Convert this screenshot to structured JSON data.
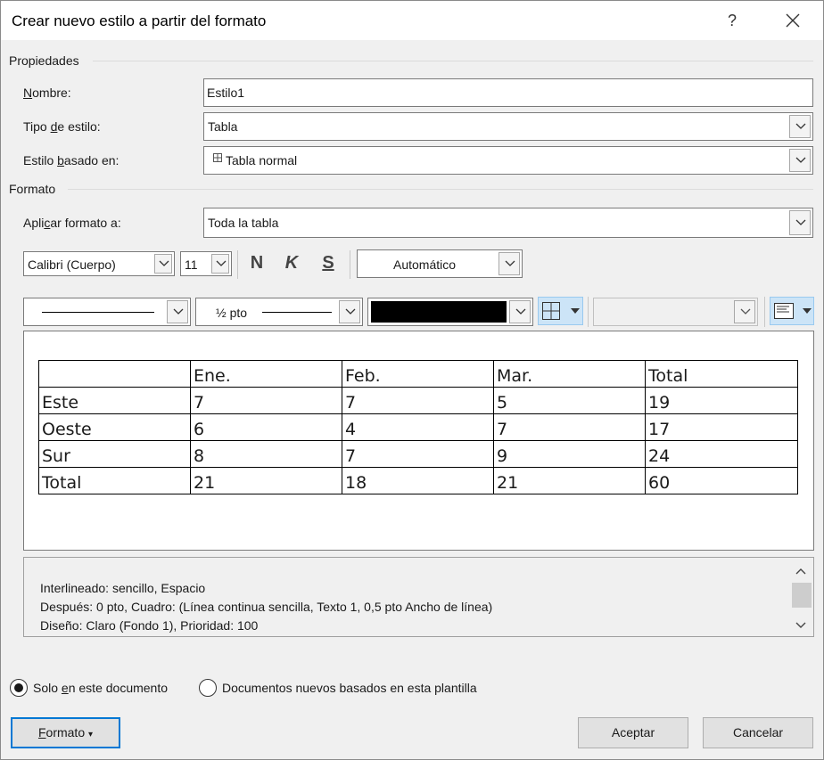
{
  "dialog": {
    "title": "Crear nuevo estilo a partir del formato",
    "help_label": "?"
  },
  "properties": {
    "section_label": "Propiedades",
    "name": {
      "label_prefix": "",
      "label_ul": "N",
      "label_rest": "ombre:",
      "value": "Estilo1"
    },
    "type": {
      "label_prefix": "Tipo ",
      "label_ul": "d",
      "label_rest": "e estilo:",
      "value": "Tabla"
    },
    "based_on": {
      "label_prefix": "Estilo ",
      "label_ul": "b",
      "label_rest": "asado en:",
      "value": "Tabla normal",
      "icon": "table-grid-icon"
    }
  },
  "format": {
    "section_label": "Formato",
    "apply_to": {
      "label_prefix": "Apli",
      "label_ul": "c",
      "label_rest": "ar formato a:",
      "value": "Toda la tabla"
    },
    "font": "Calibri (Cuerpo)",
    "size": "11",
    "bold_label": "N",
    "italic_label": "K",
    "underline_label": "S",
    "color": "Automático",
    "border_weight": "½ pto",
    "border_color_hex": "#000000",
    "borders_icon": "all-borders-icon",
    "align_icon": "cell-alignment-icon"
  },
  "preview": {
    "rows": [
      [
        "",
        "Ene.",
        "Feb.",
        "Mar.",
        "Total"
      ],
      [
        "Este",
        "7",
        "7",
        "5",
        "19"
      ],
      [
        "Oeste",
        "6",
        "4",
        "7",
        "17"
      ],
      [
        "Sur",
        "8",
        "7",
        "9",
        "24"
      ],
      [
        "Total",
        "21",
        "18",
        "21",
        "60"
      ]
    ]
  },
  "description": {
    "lines": [
      "Interlineado:  sencillo, Espacio",
      "Después:  0 pto, Cuadro: (Línea continua sencilla, Texto 1,  0,5 pto Ancho de línea)",
      "Diseño: Claro (Fondo 1), Prioridad: 100"
    ]
  },
  "scope": {
    "only_doc": {
      "prefix": "Solo ",
      "ul": "e",
      "rest": "n este documento",
      "checked": true
    },
    "new_docs": {
      "label": "Documentos nuevos basados en esta plantilla",
      "checked": false
    }
  },
  "buttons": {
    "format": {
      "ul": "F",
      "rest": "ormato",
      "arrow": "▾"
    },
    "ok": "Aceptar",
    "cancel": "Cancelar"
  }
}
